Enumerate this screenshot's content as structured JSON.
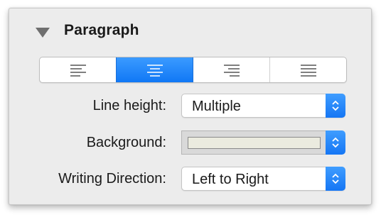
{
  "section": {
    "title": "Paragraph",
    "disclosure_icon": "disclosure-triangle-down"
  },
  "alignment": {
    "options": [
      {
        "name": "align-left",
        "icon": "align-left-icon",
        "selected": false
      },
      {
        "name": "align-center",
        "icon": "align-center-icon",
        "selected": true
      },
      {
        "name": "align-right",
        "icon": "align-right-icon",
        "selected": false
      },
      {
        "name": "align-justify",
        "icon": "align-justify-icon",
        "selected": false
      }
    ]
  },
  "line_height": {
    "label": "Line height:",
    "value": "Multiple"
  },
  "background": {
    "label": "Background:",
    "swatch_color": "#ebebdf"
  },
  "writing_direction": {
    "label": "Writing Direction:",
    "value": "Left to Right"
  },
  "colors": {
    "accent": "#1a7cf7",
    "panel": "#ececec"
  }
}
